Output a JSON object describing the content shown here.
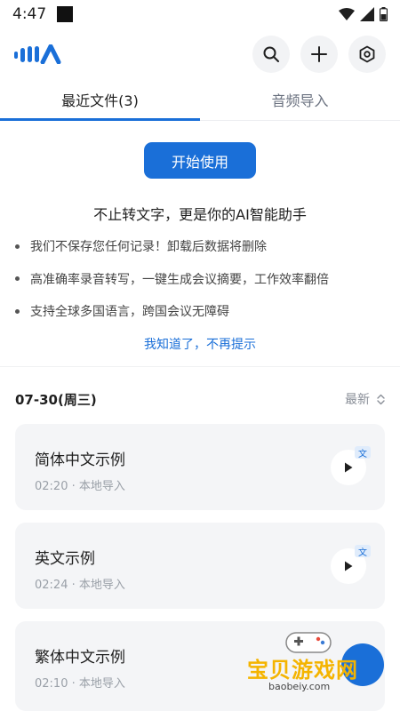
{
  "status_bar": {
    "time": "4:47"
  },
  "app_bar": {
    "logo_alt": "MIA"
  },
  "tabs": [
    {
      "label": "最近文件(3)",
      "active": true
    },
    {
      "label": "音频导入",
      "active": false
    }
  ],
  "guide": {
    "start_button": "开始使用",
    "title": "不止转文字，更是你的AI智能助手",
    "bullets": [
      "我们不保存您任何记录！卸载后数据将删除",
      "高准确率录音转写，一键生成会议摘要，工作效率翻倍",
      "支持全球多国语言，跨国会议无障碍"
    ],
    "dismiss": "我知道了，不再提示"
  },
  "list": {
    "date": "07-30(周三)",
    "sort_label": "最新",
    "items": [
      {
        "title": "简体中文示例",
        "meta": "02:20 · 本地导入",
        "badge": "文"
      },
      {
        "title": "英文示例",
        "meta": "02:24 · 本地导入",
        "badge": "文"
      },
      {
        "title": "繁体中文示例",
        "meta": "02:10 · 本地导入",
        "badge": ""
      }
    ]
  },
  "watermark": {
    "text": "宝贝游戏网",
    "url": "baobeiy.com"
  },
  "colors": {
    "accent": "#1a6fd8",
    "card_bg": "#f4f5f7",
    "icon_bg": "#f2f3f5"
  }
}
